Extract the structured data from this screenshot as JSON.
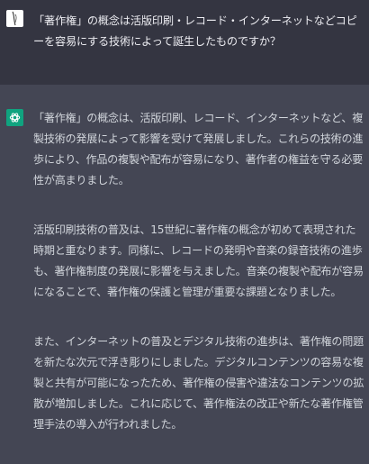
{
  "user_message": {
    "text": "「著作権」の概念は活版印刷・レコード・インターネットなどコピーを容易にする技術によって誕生したものですか？"
  },
  "assistant_message": {
    "paragraphs": [
      "「著作権」の概念は、活版印刷、レコード、インターネットなど、複製技術の発展によって影響を受けて発展しました。これらの技術の進歩により、作品の複製や配布が容易になり、著作者の権益を守る必要性が高まりました。",
      "活版印刷技術の普及は、15世紀に著作権の概念が初めて表現された時期と重なります。同様に、レコードの発明や音楽の録音技術の進歩も、著作権制度の発展に影響を与えました。音楽の複製や配布が容易になることで、著作権の保護と管理が重要な課題となりました。",
      "また、インターネットの普及とデジタル技術の進歩は、著作権の問題を新たな次元で浮き彫りにしました。デジタルコンテンツの容易な複製と共有が可能になったため、著作権の侵害や違法なコンテンツの拡散が増加しました。これに応じて、著作権法の改正や新たな著作権管理手法の導入が行われました。"
    ]
  },
  "colors": {
    "user_bg": "#343541",
    "assistant_bg": "#444654",
    "assistant_avatar": "#10a37f"
  }
}
